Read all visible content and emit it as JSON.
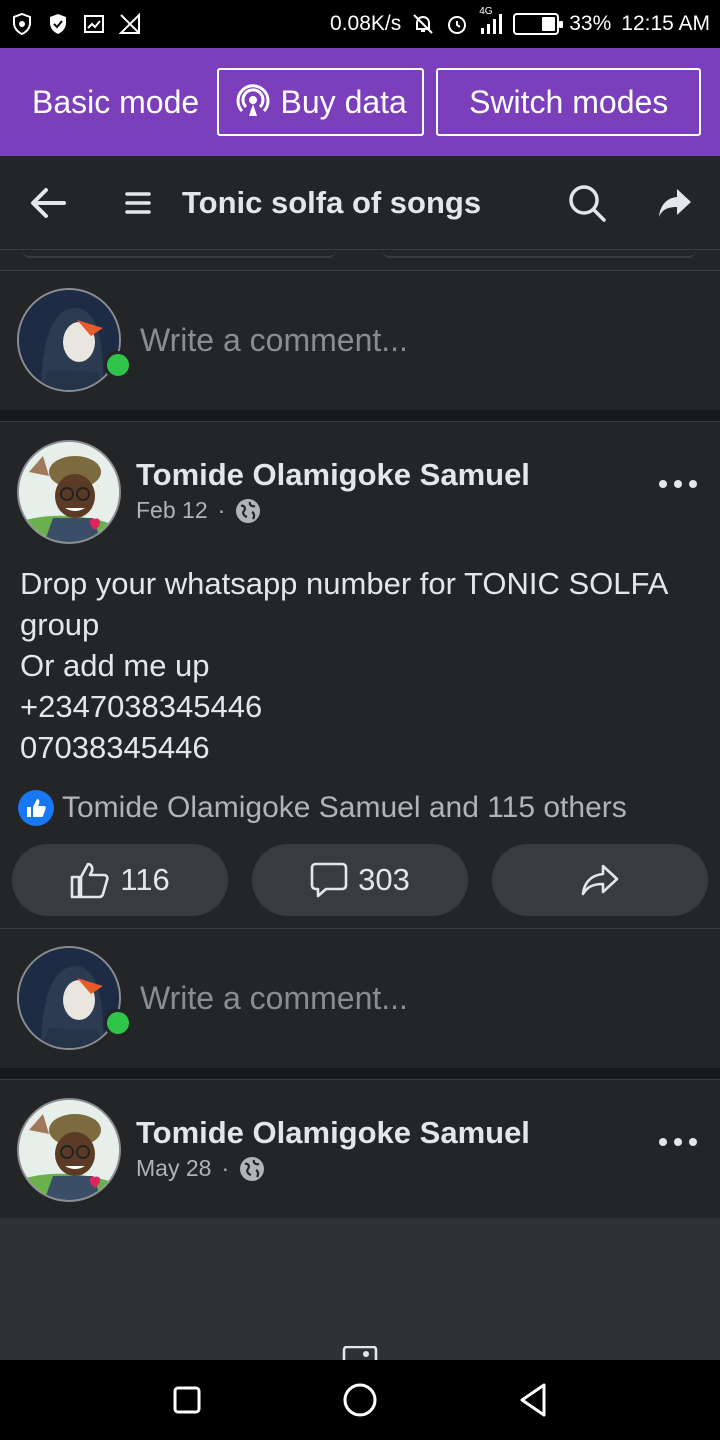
{
  "status_bar": {
    "net_speed": "0.08K/s",
    "network_type": "4G",
    "battery_percent": "33%",
    "battery_level": 0.33,
    "time": "12:15 AM",
    "icons": [
      "shield-icon",
      "shield-check-icon",
      "cast-icon",
      "no-signal-icon",
      "mute-icon",
      "alarm-icon",
      "signal-icon",
      "battery-icon"
    ]
  },
  "mode_bar": {
    "label": "Basic mode",
    "buy_data": "Buy data",
    "switch_modes": "Switch modes",
    "color": "#7b3fbc"
  },
  "header": {
    "title": "Tonic solfa of songs",
    "icons": [
      "back-arrow-icon",
      "menu-icon",
      "search-icon",
      "share-icon"
    ]
  },
  "comment_box_1": {
    "placeholder": "Write a comment..."
  },
  "post_1": {
    "author": "Tomide Olamigoke Samuel",
    "date": "Feb 12",
    "separator": "·",
    "body": "Drop your whatsapp number for TONIC SOLFA group\n Or add me up\n+2347038345446\n07038345446",
    "reactions_text": "Tomide Olamigoke Samuel and 115 others",
    "like_count": "116",
    "comment_count": "303"
  },
  "comment_box_2": {
    "placeholder": "Write a comment..."
  },
  "post_2": {
    "author": "Tomide Olamigoke Samuel",
    "date": "May 28",
    "separator": "·"
  },
  "colors": {
    "background": "#242526",
    "like_blue": "#1877f2",
    "online_green": "#31c44a"
  }
}
